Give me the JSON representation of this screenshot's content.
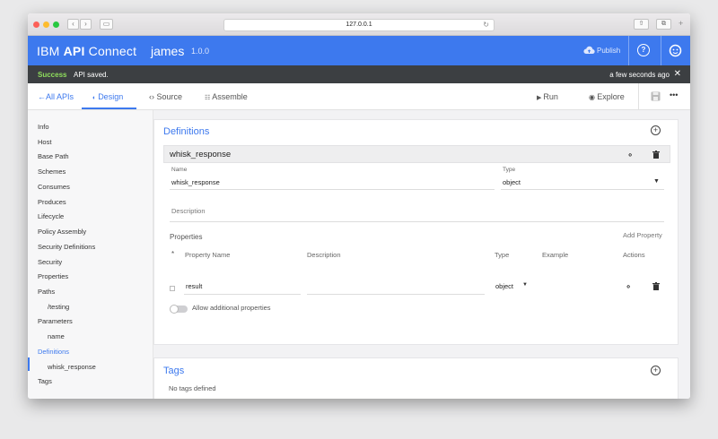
{
  "browser": {
    "url": "127.0.0.1"
  },
  "app": {
    "brand_prefix": "IBM",
    "brand_strong": "API",
    "brand_suffix": "Connect",
    "api_name": "james",
    "api_version": "1.0.0",
    "publish_label": "Publish",
    "help_glyph": "?",
    "accent_color": "#3d79ee"
  },
  "notification": {
    "status": "Success",
    "message": "API saved.",
    "time": "a few seconds ago",
    "close_glyph": "✕",
    "status_color": "#8fde5d"
  },
  "tabs": {
    "back_label": "All APIs",
    "design": "Design",
    "source": "Source",
    "assemble": "Assemble",
    "run": "Run",
    "explore": "Explore",
    "more": "•••"
  },
  "sidebar": {
    "items": [
      {
        "label": "Info"
      },
      {
        "label": "Host"
      },
      {
        "label": "Base Path"
      },
      {
        "label": "Schemes"
      },
      {
        "label": "Consumes"
      },
      {
        "label": "Produces"
      },
      {
        "label": "Lifecycle"
      },
      {
        "label": "Policy Assembly"
      },
      {
        "label": "Security Definitions"
      },
      {
        "label": "Security"
      },
      {
        "label": "Properties"
      },
      {
        "label": "Paths"
      },
      {
        "label": "/testing"
      },
      {
        "label": "Parameters"
      },
      {
        "label": "name"
      },
      {
        "label": "Definitions"
      },
      {
        "label": "whisk_response"
      },
      {
        "label": "Tags"
      }
    ]
  },
  "definitions": {
    "title": "Definitions",
    "entry_name": "whisk_response",
    "name_label": "Name",
    "name_value": "whisk_response",
    "type_label": "Type",
    "type_value": "object",
    "description_placeholder": "Description",
    "properties_label": "Properties",
    "add_property": "Add Property",
    "required_marker": "*",
    "col_property_name": "Property Name",
    "col_description": "Description",
    "col_type": "Type",
    "col_example": "Example",
    "col_actions": "Actions",
    "row_name": "result",
    "row_type": "object",
    "allow_additional": "Allow additional properties"
  },
  "tags": {
    "title": "Tags",
    "empty": "No tags defined"
  }
}
